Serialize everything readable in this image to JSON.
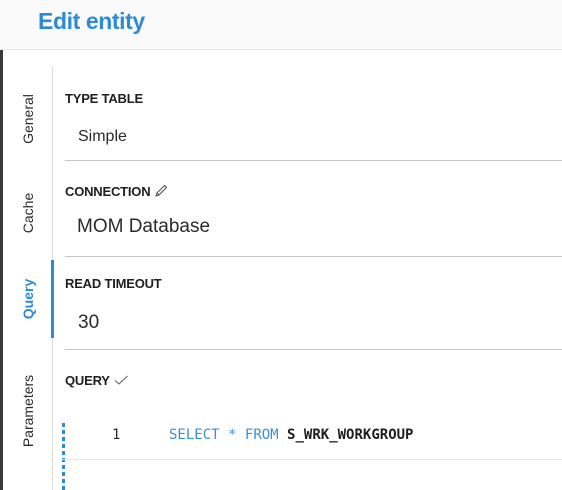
{
  "header": {
    "title": "Edit entity"
  },
  "tabs": [
    {
      "label": "General",
      "active": false
    },
    {
      "label": "Cache",
      "active": false
    },
    {
      "label": "Query",
      "active": true
    },
    {
      "label": "Parameters",
      "active": false
    }
  ],
  "fields": {
    "type_table": {
      "label": "TYPE TABLE",
      "value": "Simple"
    },
    "connection": {
      "label": "CONNECTION",
      "value": "MOM Database",
      "icon": "pencil-icon"
    },
    "read_timeout": {
      "label": "READ TIMEOUT",
      "value": "30"
    },
    "query": {
      "label": "QUERY",
      "icon": "check-icon"
    }
  },
  "code": {
    "line_number": "1",
    "tokens": {
      "kw1": "SELECT",
      "star": "*",
      "kw2": "FROM",
      "table": "S_WRK_WORKGROUP"
    }
  },
  "colors": {
    "accent": "#2d8ad6"
  }
}
